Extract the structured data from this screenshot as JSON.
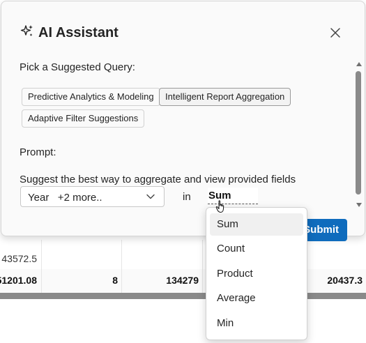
{
  "dialog": {
    "title": "AI Assistant",
    "suggested_label": "Pick a Suggested Query:",
    "chips": [
      {
        "label": "Predictive Analytics & Modeling"
      },
      {
        "label": "Intelligent Report Aggregation"
      },
      {
        "label": "Adaptive Filter Suggestions"
      }
    ],
    "prompt_label": "Prompt:",
    "prompt_text": "Suggest the best way to aggregate and view provided fields",
    "fields_select": {
      "value": "Year   +2 more.."
    },
    "in_label": "in",
    "aggregation": {
      "value": "Sum"
    },
    "submit_label": "Submit"
  },
  "dropdown": {
    "options": [
      "Sum",
      "Count",
      "Product",
      "Average",
      "Min"
    ],
    "selected": "Sum"
  },
  "grid": {
    "row_a": [
      "43572.5"
    ],
    "row_b": [
      "51201.08",
      "8",
      "134279",
      "20437.3"
    ]
  },
  "colors": {
    "accent": "#0f6cbd"
  }
}
